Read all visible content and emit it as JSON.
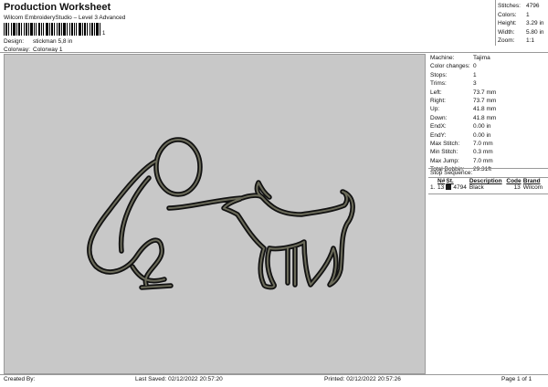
{
  "header": {
    "title": "Production Worksheet",
    "subtitle": "Wilcom EmbroideryStudio – Level 3 Advanced",
    "barcode_number": "1"
  },
  "meta": {
    "design_label": "Design:",
    "design_value": "stickman 5,8 in",
    "colorway_label": "Colorway:",
    "colorway_value": "Colorway 1"
  },
  "stats": [
    {
      "label": "Stitches:",
      "value": "4796"
    },
    {
      "label": "Colors:",
      "value": "1"
    },
    {
      "label": "Height:",
      "value": "3.29 in"
    },
    {
      "label": "Width:",
      "value": "5.80 in"
    },
    {
      "label": "Zoom:",
      "value": "1:1"
    }
  ],
  "machine_info": [
    {
      "label": "Machine:",
      "value": "Tajima"
    },
    {
      "label": "Color changes:",
      "value": "0"
    },
    {
      "label": "Stops:",
      "value": "1"
    },
    {
      "label": "Trims:",
      "value": "3"
    },
    {
      "label": "Left:",
      "value": "73.7 mm"
    },
    {
      "label": "Right:",
      "value": "73.7 mm"
    },
    {
      "label": "Up:",
      "value": "41.8 mm"
    },
    {
      "label": "Down:",
      "value": "41.8 mm"
    },
    {
      "label": "EndX:",
      "value": "0.00 in"
    },
    {
      "label": "EndY:",
      "value": "0.00 in"
    },
    {
      "label": "Max Stitch:",
      "value": "7.0 mm"
    },
    {
      "label": "Min Stitch:",
      "value": "0.3 mm"
    },
    {
      "label": "Max Jump:",
      "value": "7.0 mm"
    },
    {
      "label": "Total Bobbin:",
      "value": "29.31ft"
    }
  ],
  "stop_sequence": {
    "title": "Stop Sequence:",
    "columns": [
      "N#",
      "St.",
      "Description",
      "Code",
      "Brand"
    ],
    "rows": [
      {
        "index": "1.",
        "n": "13",
        "stitches": "4794",
        "description": "Black",
        "code": "13",
        "brand": "Wilcom",
        "color": "#1a1a1a"
      }
    ]
  },
  "footer": {
    "created_by": "Created By:",
    "last_saved": "Last Saved: 02/12/2022 20:57:20",
    "printed": "Printed: 02/12/2022 20:57:26",
    "page": "Page 1 of 1"
  },
  "colors": {
    "canvas_bg": "#c8c8c8",
    "thread": "#2b2b2b",
    "thread_outline": "#111111"
  }
}
